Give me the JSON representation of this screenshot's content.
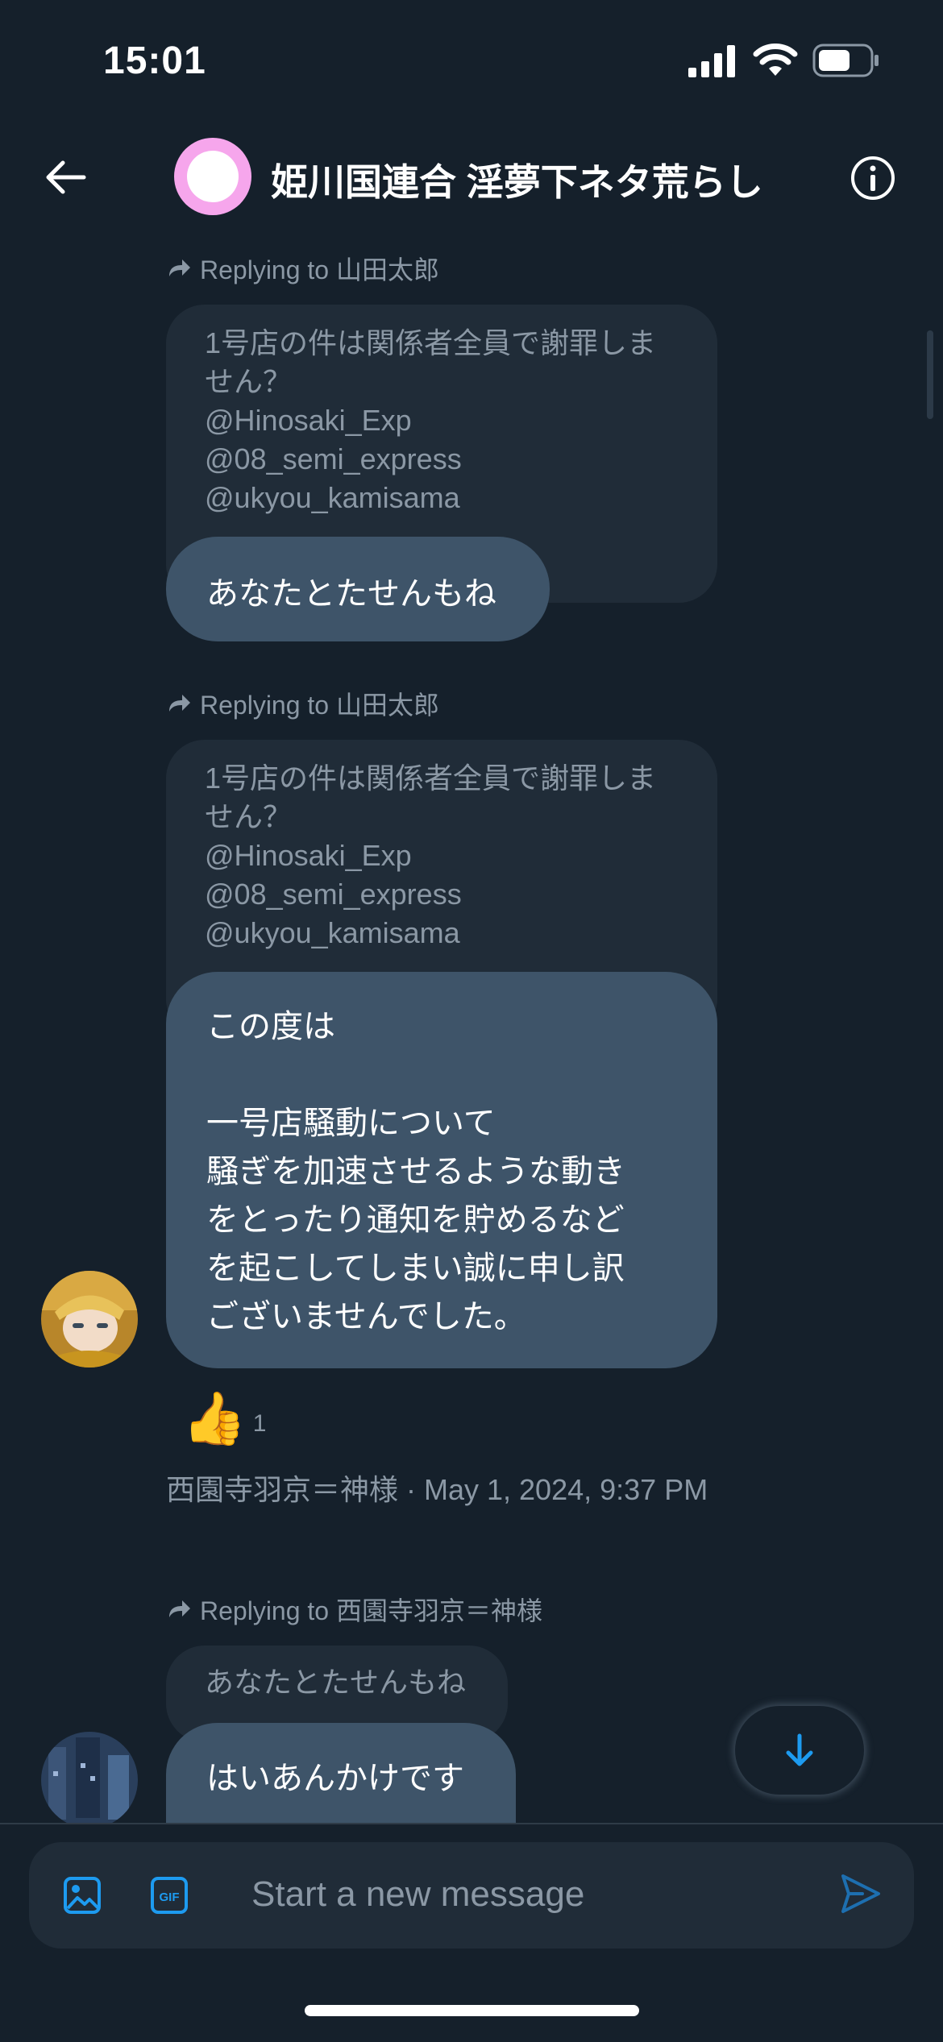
{
  "status_bar": {
    "time": "15:01",
    "icons": [
      "signal-icon",
      "wifi-icon",
      "battery-icon"
    ]
  },
  "header": {
    "title": "姫川国連合 淫夢下ネタ荒らし"
  },
  "messages": [
    {
      "reply_to": "Replying to 山田太郎",
      "quoted": [
        "1号店の件は関係者全員で謝罪しま",
        "せん？",
        "@Hinosaki_Exp",
        "@08_semi_express",
        "@ukyou_kamisama"
      ],
      "body": [
        "あなたとたせんもね"
      ]
    },
    {
      "reply_to": "Replying to 山田太郎",
      "quoted": [
        "1号店の件は関係者全員で謝罪しま",
        "せん？",
        "@Hinosaki_Exp",
        "@08_semi_express",
        "@ukyou_kamisama"
      ],
      "body": [
        "この度は",
        "",
        "一号店騒動について",
        "騒ぎを加速させるような動き",
        "をとったり通知を貯めるなど",
        "を起こしてしまい誠に申し訳",
        "ございませんでした。"
      ],
      "reaction": {
        "emoji": "👍",
        "count": "1"
      },
      "meta": "西園寺羽京＝神様 · May 1, 2024, 9:37 PM"
    },
    {
      "reply_to": "Replying to 西園寺羽京＝神様",
      "quoted": [
        "あなたとたせんもね"
      ],
      "body": [
        "はいあんかけです"
      ]
    }
  ],
  "composer": {
    "placeholder": "Start a new message"
  },
  "colors": {
    "background": "#15202b",
    "bubble": "#3e5469",
    "quoted": "#202c38",
    "accent": "#1d9bf0",
    "header_avatar": "#f6a6ec"
  }
}
